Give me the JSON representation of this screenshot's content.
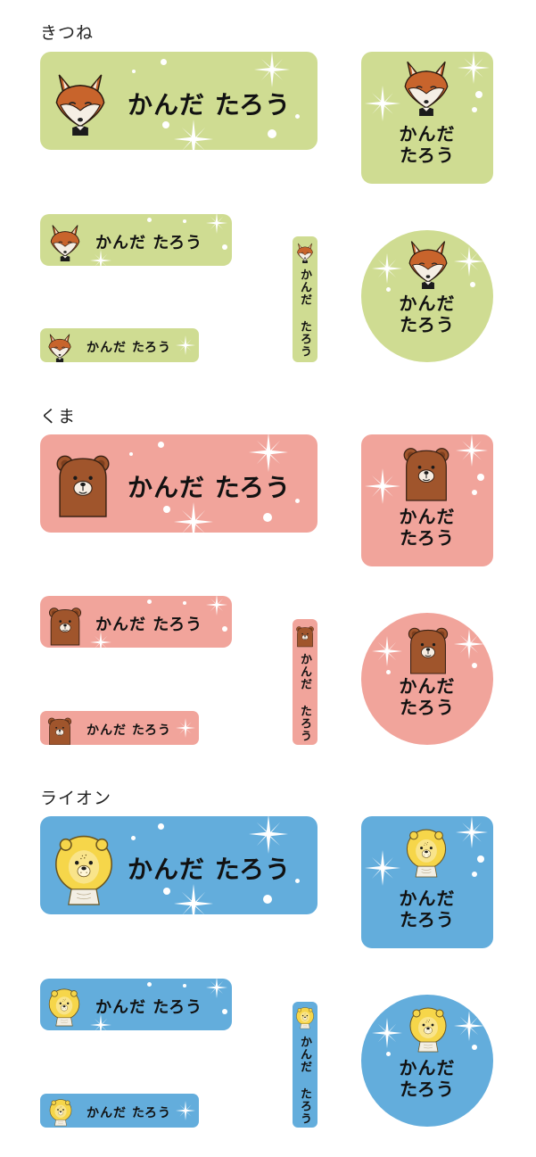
{
  "sections": [
    {
      "title": "きつね",
      "animal": "fox",
      "bg": "#cfdc92"
    },
    {
      "title": "くま",
      "animal": "bear",
      "bg": "#f1a49b"
    },
    {
      "title": "ライオン",
      "animal": "lion",
      "bg": "#63addc"
    }
  ],
  "label_name": "かんだ たろう",
  "label_name_line1": "かんだ",
  "label_name_line2": "たろう"
}
